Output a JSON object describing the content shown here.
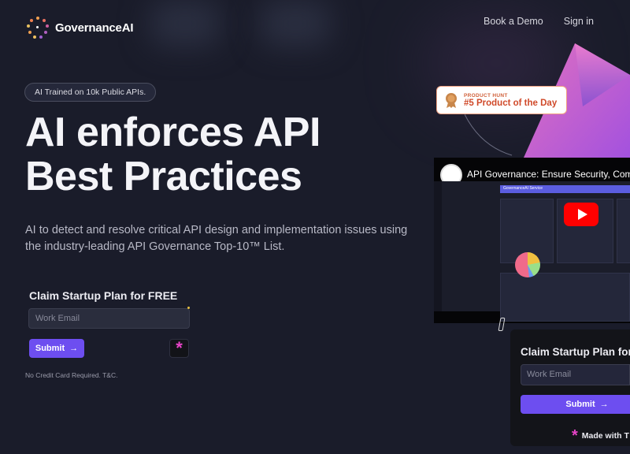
{
  "header": {
    "brand": "GovernanceAI",
    "nav": [
      {
        "label": "Book a Demo"
      },
      {
        "label": "Sign in"
      }
    ]
  },
  "hero": {
    "pill": "AI Trained on 10k Public APIs.",
    "headline_line1": "AI enforces API",
    "headline_line2": "Best Practices",
    "subtext": "AI to detect and resolve critical API design and implementation issues using the industry-leading API Governance Top-10™ List."
  },
  "signup_form": {
    "title": "Claim Startup Plan for FREE",
    "email_placeholder": "Work Email",
    "submit_label": "Submit",
    "fineprint": "No Credit Card Required. T&C."
  },
  "product_hunt": {
    "small": "PRODUCT HUNT",
    "big": "#5 Product of the Day"
  },
  "video": {
    "title": "API Governance: Ensure Security, Comp",
    "screen_header": "GovernanceAI Service"
  },
  "embedded_form": {
    "title": "Claim Startup Plan for I",
    "email_placeholder": "Work Email",
    "submit_label": "Submit",
    "made_with": "Made with T"
  },
  "colors": {
    "background": "#1a1c2a",
    "accent": "#6d4ef0",
    "asterisk": "#e844c8"
  },
  "icons": {
    "arrow": "→",
    "asterisk": "*"
  }
}
